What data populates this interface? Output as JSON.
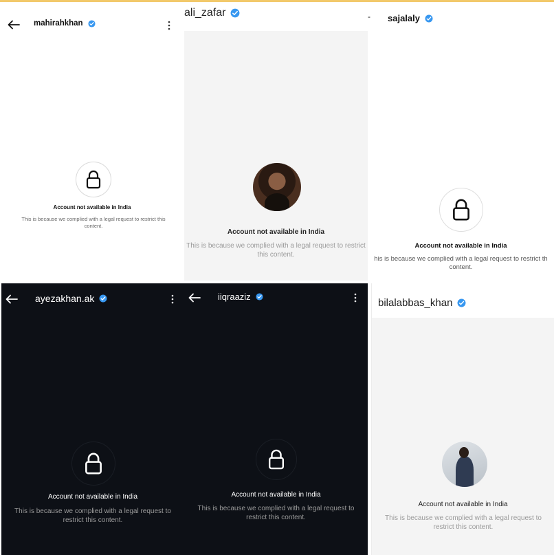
{
  "colors": {
    "verified": "#3797f0",
    "dark_bg": "#0d1016",
    "light_gray": "#f4f4f4"
  },
  "icons": {
    "back": "arrow-left-icon",
    "more": "more-vertical-icon",
    "verified": "verified-badge-icon",
    "lock": "lock-icon"
  },
  "panels": [
    {
      "username": "mahirahkhan",
      "title": "Account not available in India",
      "desc": "This is because we complied with a legal request to restrict this content."
    },
    {
      "username": "ali_zafar",
      "title": "Account not available in India",
      "desc": "This is because we complied with a legal request to restrict this content."
    },
    {
      "username": "sajalaly",
      "title": "Account not available in India",
      "desc": "his is because we complied with a legal request to restrict th content."
    },
    {
      "username": "ayezakhan.ak",
      "title": "Account not available in India",
      "desc": "This is because we complied with a legal request to restrict this content."
    },
    {
      "username": "iiqraaziz",
      "title": "Account not available in India",
      "desc": "This is because we complied with a legal request to restrict this content."
    },
    {
      "username": "bilalabbas_khan",
      "title": "Account not available in India",
      "desc": "This is because we complied with a legal request to restrict this content."
    }
  ]
}
